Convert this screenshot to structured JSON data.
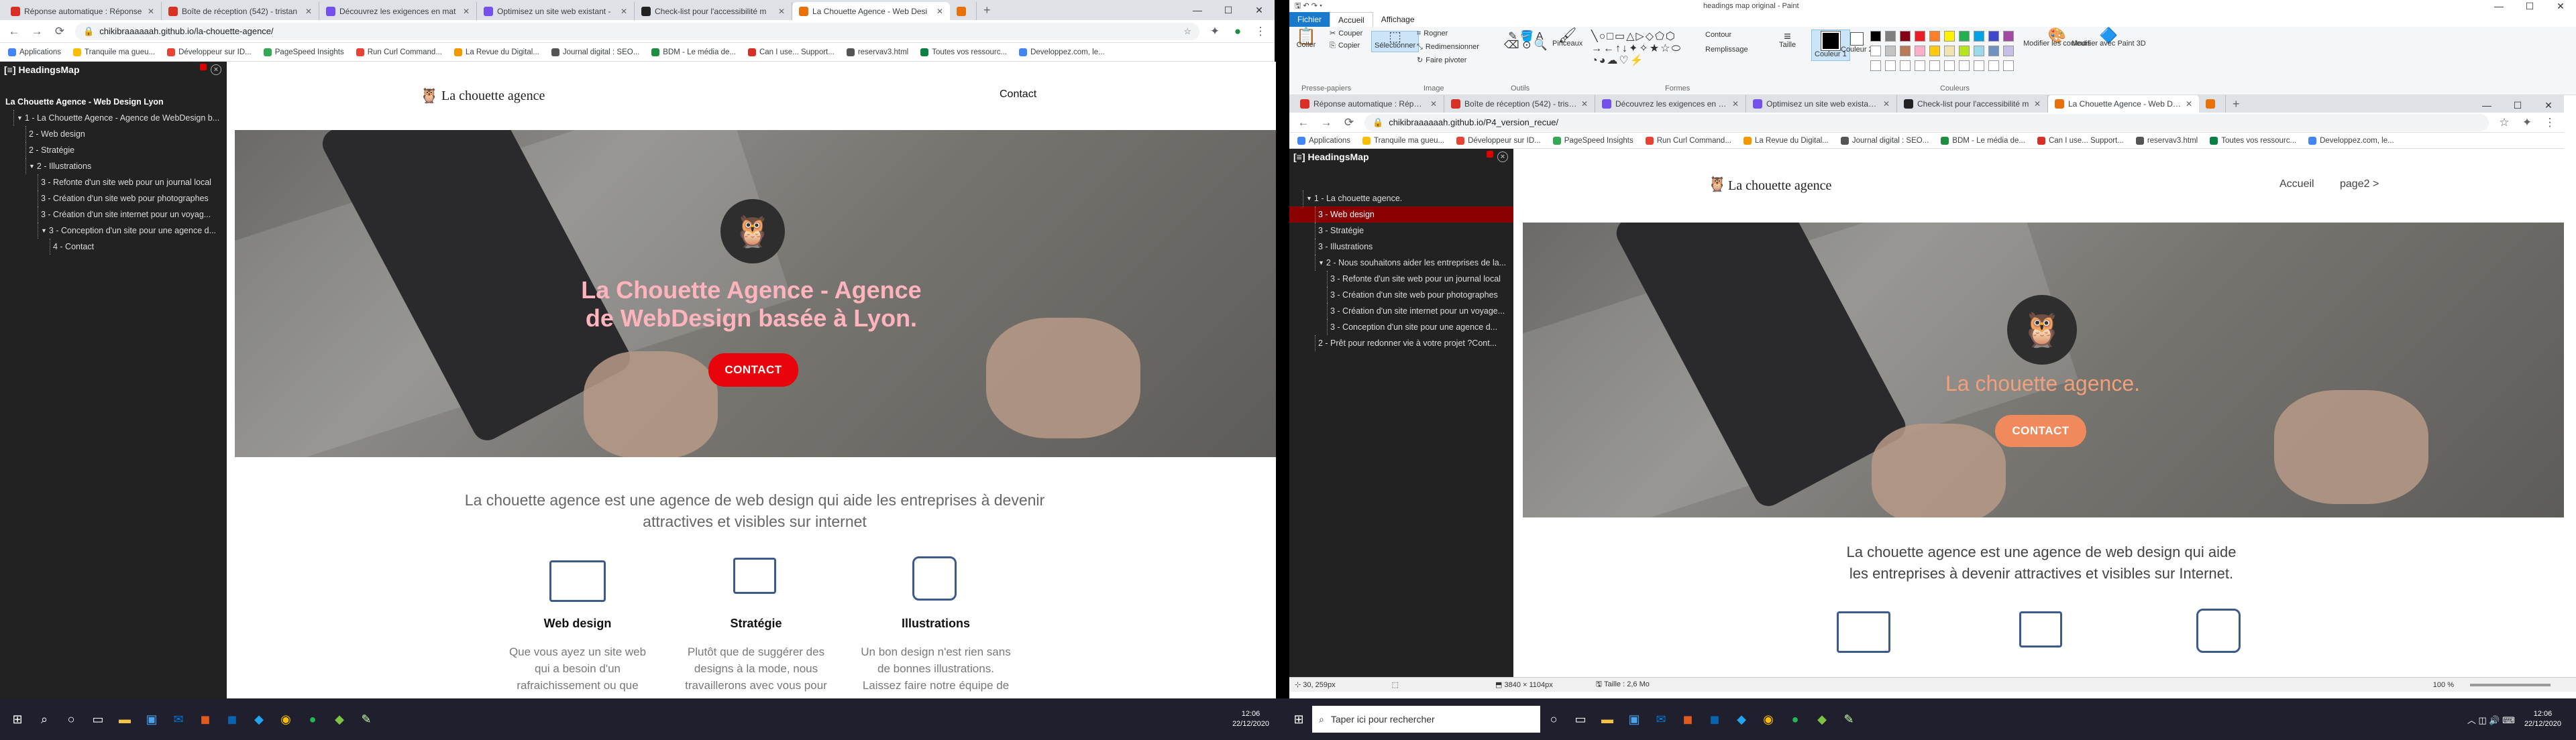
{
  "left_browser": {
    "tabs": [
      {
        "title": "Réponse automatique : Réponse",
        "icon": "gmail-icon",
        "color": "#d93025"
      },
      {
        "title": "Boîte de réception (542) - tristan",
        "icon": "gmail-icon",
        "color": "#d93025"
      },
      {
        "title": "Découvrez les exigences en mat",
        "icon": "openclassrooms-icon",
        "color": "#7451eb"
      },
      {
        "title": "Optimisez un site web existant -",
        "icon": "openclassrooms-icon",
        "color": "#7451eb"
      },
      {
        "title": "Check-list pour l'accessibilité m",
        "icon": "checklist-icon",
        "color": "#222"
      },
      {
        "title": "La Chouette Agence - Web Desi",
        "icon": "page-icon",
        "color": "#e8710a"
      },
      {
        "title": "",
        "icon": "page-icon",
        "color": "#e8710a"
      }
    ],
    "url": "chikibraaaaaah.github.io/la-chouette-agence/",
    "bookmarks": [
      "Applications",
      "Tranquile ma gueu...",
      "Développeur sur ID...",
      "PageSpeed Insights",
      "Run Curl Command...",
      "La Revue du Digital...",
      "Journal digital : SEO...",
      "BDM - Le média de...",
      "Can I use... Support...",
      "reservav3.html",
      "Toutes vos ressourc...",
      "Developpez.com, le..."
    ],
    "headingsmap": {
      "title": "HeadingsMap",
      "page_title": "La Chouette Agence - Web Design Lyon",
      "items": [
        {
          "text": "1 - La Chouette Agence - Agence de WebDesign b...",
          "level": 0,
          "toggle": "▼"
        },
        {
          "text": "2 - Web design",
          "level": 1
        },
        {
          "text": "2 - Stratégie",
          "level": 1
        },
        {
          "text": "2 - Illustrations",
          "level": 1,
          "toggle": "▼"
        },
        {
          "text": "3 - Refonte d'un site web pour un journal local",
          "level": 2
        },
        {
          "text": "3 - Création d'un site web pour photographes",
          "level": 2
        },
        {
          "text": "3 - Création d'un site internet pour un voyag...",
          "level": 2
        },
        {
          "text": "3 - Conception d'un site pour une agence d...",
          "level": 2,
          "toggle": "▼"
        },
        {
          "text": "4 - Contact",
          "level": 3
        }
      ]
    },
    "site": {
      "logo": "La chouette agence",
      "nav_contact": "Contact",
      "hero_title": "La Chouette Agence - Agence de WebDesign basée à Lyon.",
      "cta": "CONTACT",
      "intro": "La chouette agence est une agence de web design qui aide les entreprises à devenir attractives et visibles sur internet",
      "features": [
        {
          "title": "Web design",
          "desc": "Que vous ayez un site web qui a besoin d'un rafraichissement ou que"
        },
        {
          "title": "Stratégie",
          "desc": "Plutôt que de suggérer des designs à la mode, nous travaillerons avec vous pour"
        },
        {
          "title": "Illustrations",
          "desc": "Un bon design n'est rien sans de bonnes illustrations. Laissez faire notre équipe de"
        }
      ]
    }
  },
  "paint": {
    "window_title": "headings map original - Paint",
    "tabs": [
      "Fichier",
      "Accueil",
      "Affichage"
    ],
    "groups": [
      "Presse-papiers",
      "Image",
      "Outils",
      "Formes",
      "Couleurs"
    ],
    "buttons": [
      "Coller",
      "Couper",
      "Copier",
      "Sélectionner",
      "Rogner",
      "Redimensionner",
      "Faire pivoter",
      "Pinceaux",
      "Contour",
      "Remplissage",
      "Taille",
      "Couleur 1",
      "Couleur 2",
      "Modifier les couleurs",
      "Modifier avec Paint 3D"
    ],
    "palette": [
      "#000000",
      "#7f7f7f",
      "#880015",
      "#ed1c24",
      "#ff7f27",
      "#fff200",
      "#22b14c",
      "#00a2e8",
      "#3f48cc",
      "#a349a4",
      "#ffffff",
      "#c3c3c3",
      "#b97a57",
      "#ffaec9",
      "#ffc90e",
      "#efe4b0",
      "#b5e61d",
      "#99d9ea",
      "#7092be",
      "#c8bfe7"
    ],
    "status": {
      "pos": "30, 259px",
      "dims": "3840 × 1104px",
      "size": "Taille : 2,6 Mo",
      "zoom": "100 %"
    }
  },
  "right_browser": {
    "tabs": [
      {
        "title": "Réponse automatique : Réponse",
        "icon": "gmail-icon",
        "color": "#d93025"
      },
      {
        "title": "Boîte de réception (542) - tristan",
        "icon": "gmail-icon",
        "color": "#d93025"
      },
      {
        "title": "Découvrez les exigences en mat",
        "icon": "openclassrooms-icon",
        "color": "#7451eb"
      },
      {
        "title": "Optimisez un site web existant -",
        "icon": "openclassrooms-icon",
        "color": "#7451eb"
      },
      {
        "title": "Check-list pour l'accessibilité m",
        "icon": "checklist-icon",
        "color": "#222"
      },
      {
        "title": "La Chouette Agence - Web Desi",
        "icon": "page-icon",
        "color": "#e8710a"
      },
      {
        "title": "",
        "icon": "page-icon",
        "color": "#e8710a"
      }
    ],
    "url": "chikibraaaaaah.github.io/P4_version_recue/",
    "bookmarks": [
      "Applications",
      "Tranquile ma gueu...",
      "Développeur sur ID...",
      "PageSpeed Insights",
      "Run Curl Command...",
      "La Revue du Digital...",
      "Journal digital : SEO...",
      "BDM - Le média de...",
      "Can I use... Support...",
      "reservav3.html",
      "Toutes vos ressourc...",
      "Developpez.com, le..."
    ],
    "headingsmap": {
      "title": "HeadingsMap",
      "items": [
        {
          "text": "1 - La chouette agence.",
          "level": 0,
          "toggle": "▼"
        },
        {
          "text": "3 - Web design",
          "level": 1,
          "selected": true
        },
        {
          "text": "3 - Stratégie",
          "level": 1
        },
        {
          "text": "3 - Illustrations",
          "level": 1
        },
        {
          "text": "2 - Nous souhaitons aider les entreprises de la...",
          "level": 1,
          "toggle": "▼"
        },
        {
          "text": "3 - Refonte d'un site web pour un journal local",
          "level": 2
        },
        {
          "text": "3 - Création d'un site web pour photographes",
          "level": 2
        },
        {
          "text": "3 - Création d'un site internet pour un voyage...",
          "level": 2
        },
        {
          "text": "3 - Conception d'un site pour une agence d...",
          "level": 2
        },
        {
          "text": "2 - Prêt pour redonner vie à votre projet ?Cont...",
          "level": 1
        }
      ]
    },
    "site": {
      "logo": "La chouette agence",
      "nav": [
        "Accueil",
        "page2 >"
      ],
      "hero_title": "La chouette agence.",
      "cta": "CONTACT",
      "intro": "La chouette agence est une agence de web design qui aide les entreprises à devenir attractives et visibles sur Internet."
    }
  },
  "taskbar_left": {
    "search": "",
    "time": "12:06",
    "date": "22/12/2020"
  },
  "taskbar_right": {
    "search": "Taper ici pour rechercher",
    "time": "12:06",
    "date": "22/12/2020"
  }
}
